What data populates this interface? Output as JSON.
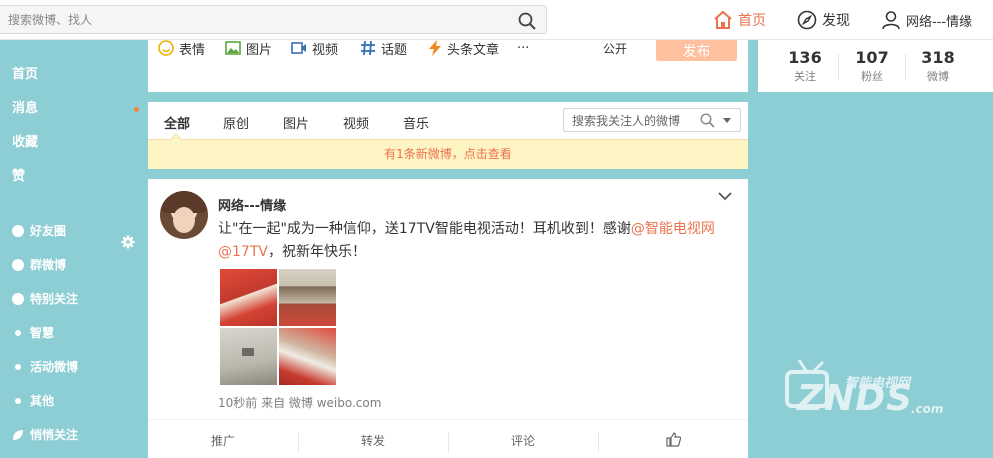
{
  "topbar": {
    "search_placeholder": "搜索微博、找人",
    "nav": [
      {
        "label": "首页",
        "icon": "home-icon",
        "active": true
      },
      {
        "label": "发现",
        "icon": "compass-icon"
      },
      {
        "label": "网络---情缘",
        "icon": "user-icon"
      }
    ]
  },
  "sidebar": {
    "main_items": [
      "首页",
      "消息",
      "收藏",
      "赞"
    ],
    "groups": [
      {
        "label": "好友圈",
        "icon": "friends-icon"
      },
      {
        "label": "群微博",
        "icon": "group-icon"
      },
      {
        "label": "特别关注",
        "icon": "star-follow-icon"
      },
      {
        "label": "智慧",
        "icon": "dot-icon"
      },
      {
        "label": "活动微博",
        "icon": "dot-icon"
      },
      {
        "label": "其他",
        "icon": "dot-icon"
      },
      {
        "label": "悄悄关注",
        "icon": "leaf-icon"
      }
    ]
  },
  "composer": {
    "tools": [
      {
        "label": "表情",
        "icon": "emoji-icon"
      },
      {
        "label": "图片",
        "icon": "image-icon"
      },
      {
        "label": "视频",
        "icon": "video-icon"
      },
      {
        "label": "话题",
        "icon": "hashtag-icon"
      },
      {
        "label": "头条文章",
        "icon": "article-icon"
      },
      {
        "label": "···",
        "icon": "more-icon"
      }
    ],
    "visibility": "公开",
    "post_label": "发布"
  },
  "stats": [
    {
      "value": "136",
      "label": "关注"
    },
    {
      "value": "107",
      "label": "粉丝"
    },
    {
      "value": "318",
      "label": "微博"
    }
  ],
  "filter": {
    "tabs": [
      "全部",
      "原创",
      "图片",
      "视频",
      "音乐"
    ],
    "active_tab": "全部",
    "search_placeholder": "搜索我关注人的微博"
  },
  "new_posts_banner": "有1条新微博，点击查看",
  "post": {
    "author": "网络---情缘",
    "text_before": "让\"在一起\"成为一种信仰，送17TV智能电视活动！耳机收到！感谢",
    "mention": "@智能电视网@17TV",
    "text_after": "，祝新年快乐！",
    "meta": "10秒前 来自 微博 weibo.com",
    "actions": [
      "推广",
      "转发",
      "评论",
      "like-icon"
    ]
  },
  "watermark": {
    "brand": "ZNDS",
    "domain_suffix": ".com",
    "cn_name": "智能电视网"
  },
  "colors": {
    "accent": "#eb7350",
    "background": "#8dcdd4",
    "banner_bg": "#fef3c2",
    "post_button_bg": "#ffc09f"
  }
}
